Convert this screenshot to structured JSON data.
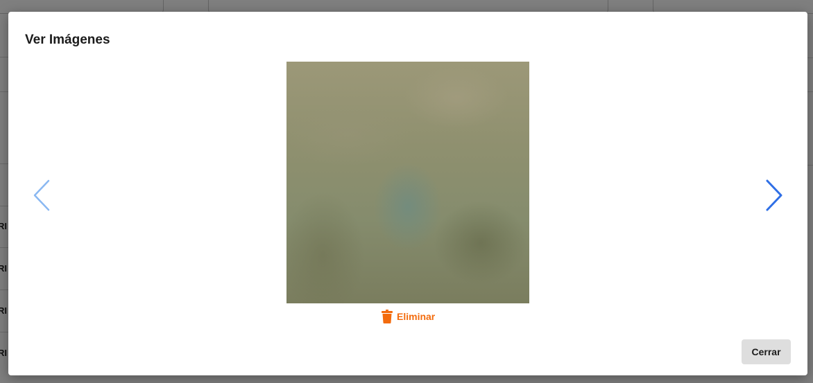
{
  "modal": {
    "title": "Ver Imágenes",
    "delete_label": "Eliminar",
    "close_label": "Cerrar"
  },
  "background": {
    "row_fragment": "RI"
  },
  "colors": {
    "delete_accent": "#f36b0d",
    "next_arrow": "#2f6fe6",
    "prev_arrow_disabled": "#8ab8f2",
    "close_button_bg": "#dedede"
  },
  "icons": {
    "prev": "chevron-left-icon",
    "next": "chevron-right-icon",
    "delete": "trash-icon"
  }
}
